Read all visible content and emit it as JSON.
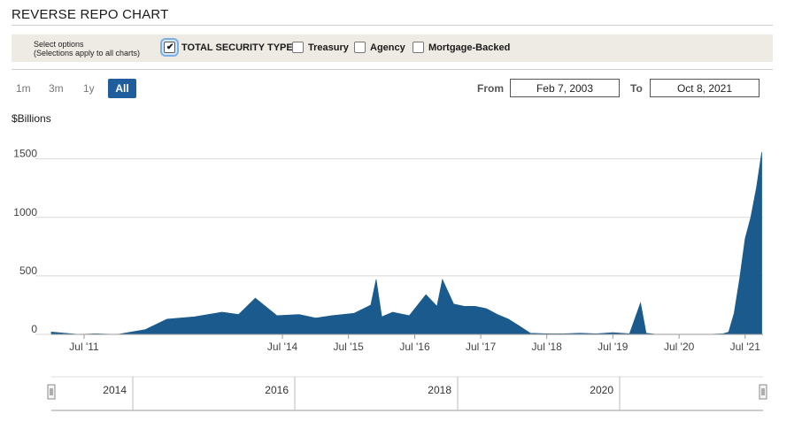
{
  "header": {
    "title": "REVERSE REPO CHART"
  },
  "options": {
    "caption_line1": "Select options",
    "caption_line2": "(Selections apply to all charts)",
    "items": [
      {
        "label": "TOTAL SECURITY TYPES",
        "checked": true
      },
      {
        "label": "Treasury",
        "checked": false
      },
      {
        "label": "Agency",
        "checked": false
      },
      {
        "label": "Mortgage-Backed",
        "checked": false
      }
    ]
  },
  "range_buttons": {
    "b1m": "1m",
    "b3m": "3m",
    "b1y": "1y",
    "ball": "All",
    "selected": "All"
  },
  "date_range": {
    "from_label": "From",
    "from_value": "Feb 7, 2003",
    "to_label": "To",
    "to_value": "Oct 8, 2021"
  },
  "colors": {
    "bar": "#1a5a8c",
    "accent": "#1f5d9c",
    "options_bg": "#eeeae4"
  },
  "navigator": {
    "labels": [
      "2014",
      "2016",
      "2018",
      "2020"
    ]
  },
  "chart_data": {
    "type": "area",
    "ylabel": "$Billions",
    "ylim": [
      0,
      1800
    ],
    "yticks": [
      0,
      500,
      1000,
      1500
    ],
    "xticks": [
      "Jul '11",
      "Jul '14",
      "Jul '15",
      "Jul '16",
      "Jul '17",
      "Jul '18",
      "Jul '19",
      "Jul '20",
      "Jul '21"
    ],
    "grid": true,
    "legend": "none",
    "series": [
      {
        "x": [
          "2011-01",
          "2011-06",
          "2011-09",
          "2012-01",
          "2012-06",
          "2012-10",
          "2013-03",
          "2013-08",
          "2013-11",
          "2014-02",
          "2014-06",
          "2014-10",
          "2015-01",
          "2015-04",
          "2015-08",
          "2015-11",
          "2015-12",
          "2016-01",
          "2016-03",
          "2016-06",
          "2016-09",
          "2016-11",
          "2016-12",
          "2017-02",
          "2017-04",
          "2017-06",
          "2017-08",
          "2017-10",
          "2017-12",
          "2018-02",
          "2018-04",
          "2018-07",
          "2018-10",
          "2019-01",
          "2019-04",
          "2019-07",
          "2019-10",
          "2019-12",
          "2020-01",
          "2020-03",
          "2020-06",
          "2020-09",
          "2020-12",
          "2021-03",
          "2021-04",
          "2021-05",
          "2021-06",
          "2021-07",
          "2021-08",
          "2021-09",
          "2021-10"
        ],
        "y": [
          20,
          0,
          5,
          0,
          40,
          130,
          150,
          190,
          170,
          310,
          160,
          170,
          140,
          160,
          180,
          250,
          470,
          150,
          190,
          160,
          340,
          240,
          470,
          260,
          240,
          240,
          220,
          170,
          130,
          70,
          10,
          5,
          5,
          10,
          5,
          15,
          5,
          270,
          10,
          0,
          0,
          0,
          0,
          5,
          20,
          180,
          480,
          820,
          1000,
          1250,
          1560
        ]
      }
    ]
  }
}
